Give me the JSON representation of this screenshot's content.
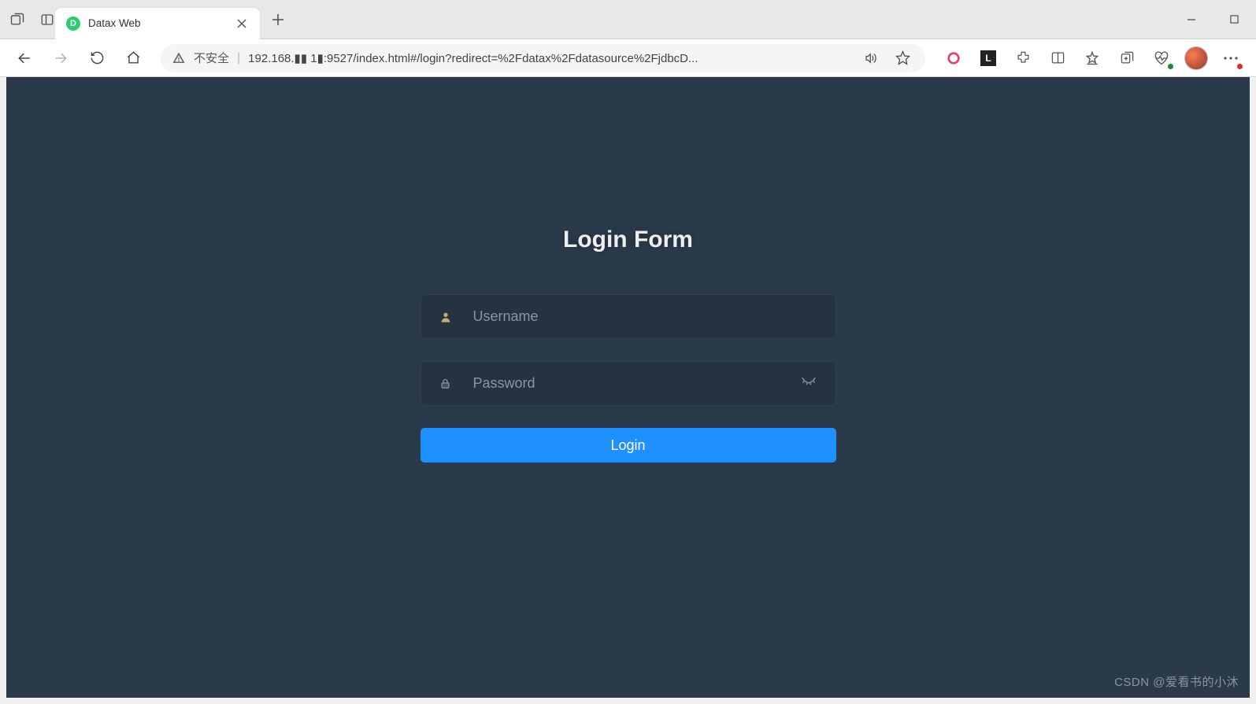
{
  "browser": {
    "tab": {
      "title": "Datax Web",
      "favicon_letter": "D"
    },
    "security_label": "不安全",
    "url_display": "192.168.▮▮ 1▮:9527/index.html#/login?redirect=%2Fdatax%2Fdatasource%2FjdbcD..."
  },
  "page": {
    "title": "Login Form",
    "username": {
      "placeholder": "Username",
      "value": ""
    },
    "password": {
      "placeholder": "Password",
      "value": ""
    },
    "login_button": "Login"
  },
  "watermark": "CSDN @爱看书的小沐"
}
